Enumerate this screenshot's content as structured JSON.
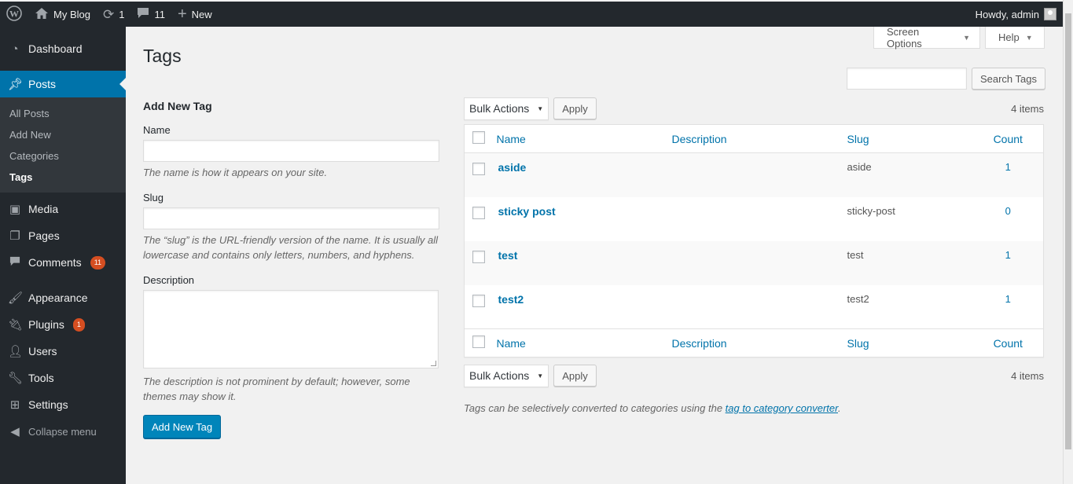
{
  "adminbar": {
    "site_name": "My Blog",
    "updates_count": "1",
    "comments_count": "11",
    "new_label": "New",
    "howdy": "Howdy, admin"
  },
  "menu": {
    "dashboard": "Dashboard",
    "posts": "Posts",
    "sub": [
      "All Posts",
      "Add New",
      "Categories",
      "Tags"
    ],
    "media": "Media",
    "pages": "Pages",
    "comments": "Comments",
    "comments_badge": "11",
    "appearance": "Appearance",
    "plugins": "Plugins",
    "plugins_badge": "1",
    "users": "Users",
    "tools": "Tools",
    "settings": "Settings",
    "collapse": "Collapse menu"
  },
  "screen_meta": {
    "screen_options": "Screen Options",
    "help": "Help"
  },
  "page": {
    "title": "Tags",
    "search_button": "Search Tags",
    "search_value": ""
  },
  "form": {
    "title": "Add New Tag",
    "name_label": "Name",
    "name_value": "",
    "name_desc": "The name is how it appears on your site.",
    "slug_label": "Slug",
    "slug_value": "",
    "slug_desc": "The “slug” is the URL-friendly version of the name. It is usually all lowercase and contains only letters, numbers, and hyphens.",
    "description_label": "Description",
    "description_desc": "The description is not prominent by default; however, some themes may show it.",
    "submit": "Add New Tag"
  },
  "table": {
    "bulk_actions": "Bulk Actions",
    "apply": "Apply",
    "items_count": "4 items",
    "columns": {
      "name": "Name",
      "description": "Description",
      "slug": "Slug",
      "count": "Count"
    },
    "rows": [
      {
        "name": "aside",
        "description": "",
        "slug": "aside",
        "count": "1"
      },
      {
        "name": "sticky post",
        "description": "",
        "slug": "sticky-post",
        "count": "0"
      },
      {
        "name": "test",
        "description": "",
        "slug": "test",
        "count": "1"
      },
      {
        "name": "test2",
        "description": "",
        "slug": "test2",
        "count": "1"
      }
    ]
  },
  "footer_note": {
    "text": "Tags can be selectively converted to categories using the ",
    "link": "tag to category converter",
    "end": "."
  },
  "colors": {
    "accent": "#0073aa",
    "adminbar": "#23282d",
    "badge": "#d54e21",
    "primary_button": "#0085ba"
  }
}
